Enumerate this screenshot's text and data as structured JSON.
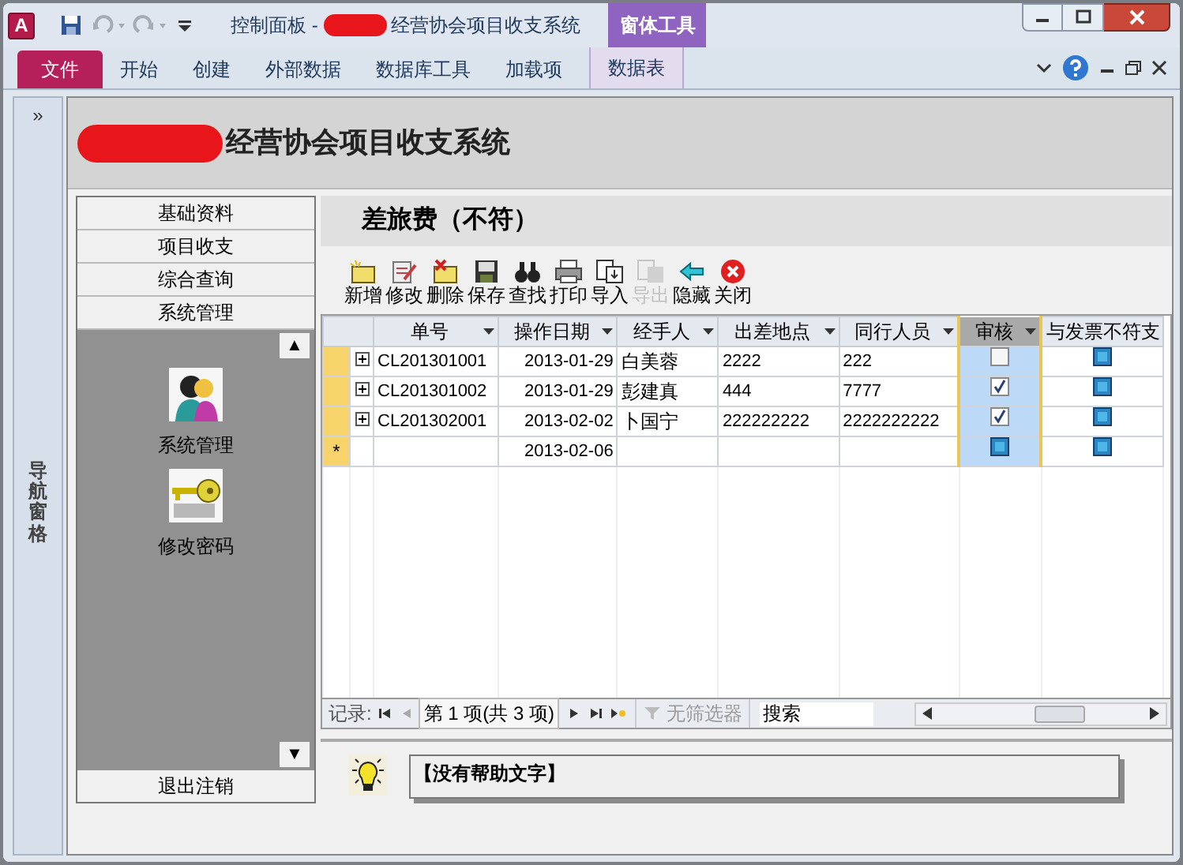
{
  "app_logo": "A",
  "window": {
    "title_prefix": "控制面板 -",
    "title": "经营协会项目收支系统",
    "context_group": "窗体工具"
  },
  "ribbon_tabs": [
    {
      "label": "文件",
      "kind": "file"
    },
    {
      "label": "开始",
      "kind": "normal"
    },
    {
      "label": "创建",
      "kind": "normal"
    },
    {
      "label": "外部数据",
      "kind": "normal"
    },
    {
      "label": "数据库工具",
      "kind": "normal"
    },
    {
      "label": "加载项",
      "kind": "normal"
    },
    {
      "label": "数据表",
      "kind": "contextual"
    }
  ],
  "nav_pane": {
    "expand": "»",
    "label": "导航窗格"
  },
  "form": {
    "title": "经营协会项目收支系统",
    "menu": [
      {
        "label": "基础资料"
      },
      {
        "label": "项目收支"
      },
      {
        "label": "综合查询"
      },
      {
        "label": "系统管理"
      }
    ],
    "menu_items": [
      {
        "label": "系统管理"
      },
      {
        "label": "修改密码"
      }
    ],
    "scroll_up": "▲",
    "scroll_down": "▼",
    "exit": "退出注销"
  },
  "subform": {
    "title": "差旅费（不符）",
    "toolbar": [
      {
        "label": "新增",
        "disabled": false
      },
      {
        "label": "修改",
        "disabled": false
      },
      {
        "label": "删除",
        "disabled": false
      },
      {
        "label": "保存",
        "disabled": false
      },
      {
        "label": "查找",
        "disabled": false
      },
      {
        "label": "打印",
        "disabled": false
      },
      {
        "label": "导入",
        "disabled": false
      },
      {
        "label": "导出",
        "disabled": true
      },
      {
        "label": "隐藏",
        "disabled": false
      },
      {
        "label": "关闭",
        "disabled": false
      }
    ],
    "columns": [
      {
        "label": "单号",
        "selected": false
      },
      {
        "label": "操作日期",
        "selected": false
      },
      {
        "label": "经手人",
        "selected": false
      },
      {
        "label": "出差地点",
        "selected": false
      },
      {
        "label": "同行人员",
        "selected": false
      },
      {
        "label": "审核",
        "selected": true
      },
      {
        "label": "与发票不符支",
        "selected": false
      }
    ],
    "rows": [
      {
        "id": "CL201301001",
        "date": "2013-01-29",
        "handler": "白美蓉",
        "place": "2222",
        "companions": "222",
        "audit_checked": false,
        "mismatch_blank": true
      },
      {
        "id": "CL201301002",
        "date": "2013-01-29",
        "handler": "彭建真",
        "place": "444",
        "companions": "7777",
        "audit_checked": true,
        "mismatch_blank": true
      },
      {
        "id": "CL201302001",
        "date": "2013-02-02",
        "handler": "卜国宁",
        "place": "222222222",
        "companions": "2222222222",
        "audit_checked": true,
        "mismatch_blank": true
      }
    ],
    "new_row": {
      "marker": "*",
      "date": "2013-02-06",
      "audit_blank": true,
      "mismatch_blank": true
    },
    "record_nav": {
      "label": "记录:",
      "position": "第 1 项(共 3 项)",
      "filter": "无筛选器",
      "search_placeholder": "搜索"
    },
    "help_text": "【没有帮助文字】"
  }
}
